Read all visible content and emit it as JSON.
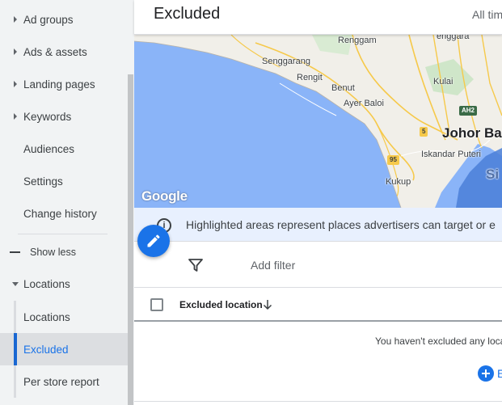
{
  "sidebar": {
    "items": [
      {
        "label": "Ad groups"
      },
      {
        "label": "Ads & assets"
      },
      {
        "label": "Landing pages"
      },
      {
        "label": "Keywords"
      },
      {
        "label": "Audiences"
      },
      {
        "label": "Settings"
      },
      {
        "label": "Change history"
      }
    ],
    "show_less": "Show less",
    "section": "Locations",
    "sub_items": [
      {
        "label": "Locations"
      },
      {
        "label": "Excluded"
      },
      {
        "label": "Per store report"
      }
    ]
  },
  "header": {
    "title": "Excluded",
    "date_range": "All tim"
  },
  "map": {
    "labels": {
      "renggam": "Renggam",
      "senggarang": "Senggarang",
      "rengit": "Rengit",
      "benut": "Benut",
      "ayer_baloi": "Ayer Baloi",
      "kulai": "Kulai",
      "johor": "Johor Ba",
      "iskandar": "Iskandar Puteri",
      "kukup": "Kukup",
      "sin": "Si",
      "tenggara": "enggara"
    },
    "badges": {
      "ah2": "AH2",
      "r5": "5",
      "r95": "95"
    },
    "logo": "Google"
  },
  "banner": {
    "info_glyph": "i",
    "text": "Highlighted areas represent places advertisers can target or e"
  },
  "filter": {
    "add_filter": "Add filter"
  },
  "table": {
    "column": "Excluded location"
  },
  "empty": {
    "message": "You haven't excluded any loca",
    "add_label": "E"
  },
  "colors": {
    "accent": "#1a73e8",
    "water": "#8ab4f8",
    "land": "#f1efe9"
  }
}
